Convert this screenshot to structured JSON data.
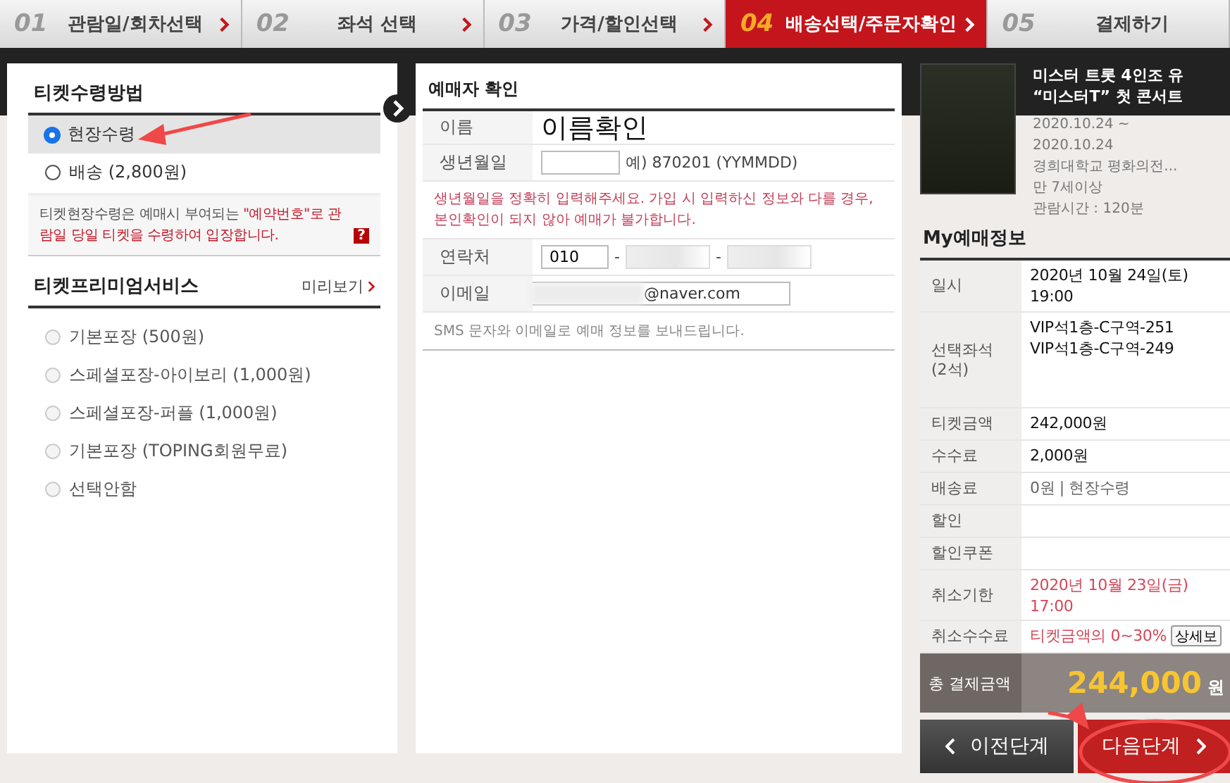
{
  "steps": [
    {
      "number": "01",
      "label": "관람일/회차선택",
      "selected": false
    },
    {
      "number": "02",
      "label": "좌석 선택",
      "selected": false
    },
    {
      "number": "03",
      "label": "가격/할인선택",
      "selected": false
    },
    {
      "number": "04",
      "label": "배송선택/주문자확인",
      "selected": true
    },
    {
      "number": "05",
      "label": "결제하기",
      "selected": false
    }
  ],
  "ticket_receipt": {
    "title": "티켓수령방법",
    "options": [
      {
        "label": "현장수령",
        "selected": true
      },
      {
        "label": "배송 (2,800원)",
        "selected": false
      }
    ],
    "notice": [
      {
        "text": "티켓현장수령은 예매시 부여되는 ",
        "kind": "normal"
      },
      {
        "text": "\"예약번호\"",
        "kind": "highlight"
      },
      {
        "text": "로 관람일 당일 티켓을 수령하여 입장합니다.",
        "kind": "highlight"
      }
    ],
    "help_icon": "?"
  },
  "premium_service": {
    "title": "티켓프리미엄서비스",
    "preview_link": "미리보기",
    "options": [
      {
        "label": "기본포장 (500원)",
        "selected": false,
        "disabled": true
      },
      {
        "label": "스페셜포장-아이보리 (1,000원)",
        "selected": false,
        "disabled": true
      },
      {
        "label": "스페셜포장-퍼플 (1,000원)",
        "selected": false,
        "disabled": true
      },
      {
        "label": "기본포장 (TOPING회원무료)",
        "selected": false,
        "disabled": true
      },
      {
        "label": "선택안함",
        "selected": false,
        "disabled": true
      }
    ]
  },
  "booker": {
    "title": "예매자 확인",
    "name": {
      "label": "이름",
      "value": "이름확인"
    },
    "birth": {
      "label": "생년월일",
      "hint": "예) 870201 (YYMMDD)"
    },
    "warning": "생년월일을 정확히 입력해주세요. 가입 시 입력하신 정보와 다를 경우, 본인확인이 되지 않아 예매가 불가합니다.",
    "phone": {
      "label": "연락처",
      "first": "010",
      "separator": "-"
    },
    "email": {
      "label": "이메일",
      "value": "@naver.com"
    },
    "note": "SMS 문자와 이메일로 예매 정보를 보내드립니다."
  },
  "show": {
    "title_lines": [
      "미스터 트롯 4인조 유",
      "“미스터T” 첫 콘서트"
    ],
    "details": [
      "2020.10.24 ~",
      "2020.10.24",
      "경희대학교 평화의전...",
      "만 7세이상",
      "관람시간 : 120분"
    ]
  },
  "my_booking": {
    "title": "My예매정보",
    "rows": [
      {
        "label": "일시",
        "value": "2020년 10월 24일(토)\n19:00",
        "kind": "normal"
      },
      {
        "label": "선택좌석\n(2석)",
        "value": "VIP석1층-C구역-251\nVIP석1층-C구역-249",
        "kind": "seats"
      },
      {
        "label": "티켓금액",
        "value": "242,000원",
        "kind": "normal"
      },
      {
        "label": "수수료",
        "value": "2,000원",
        "kind": "normal"
      },
      {
        "label": "배송료",
        "value": "0원 | 현장수령",
        "kind": "muted"
      },
      {
        "label": "할인",
        "kind": "normal"
      },
      {
        "label": "할인쿠폰",
        "kind": "normal"
      },
      {
        "label": "취소기한",
        "value": "2020년 10월 23일(금)\n17:00",
        "kind": "alert"
      },
      {
        "label": "취소수수료",
        "value": "티켓금액의 0~30%",
        "kind": "alert",
        "button": "상세보"
      }
    ],
    "total": {
      "label": "총 결제금액",
      "amount": "244,000",
      "unit": "원"
    }
  },
  "buttons": {
    "prev": "이전단계",
    "next": "다음단계"
  }
}
